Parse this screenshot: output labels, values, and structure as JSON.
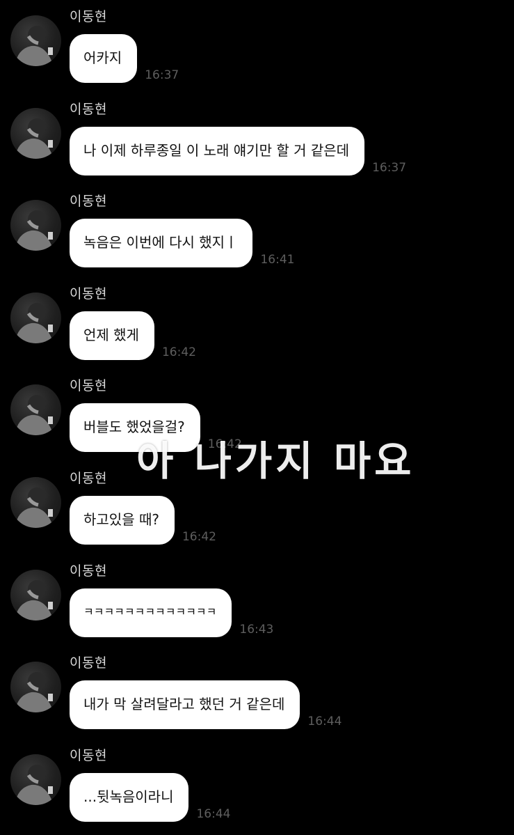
{
  "messages": [
    {
      "sender": "이동현",
      "text": "어카지",
      "time": "16:37"
    },
    {
      "sender": "이동현",
      "text": "나 이제 하루종일 이 노래 얘기만 할 거 같은데",
      "time": "16:37"
    },
    {
      "sender": "이동현",
      "text": "녹음은 이번에 다시 했지ㅣ",
      "time": "16:41"
    },
    {
      "sender": "이동현",
      "text": "언제 했게",
      "time": "16:42"
    },
    {
      "sender": "이동현",
      "text": "버블도 했었을걸?",
      "time": "16:42"
    },
    {
      "sender": "이동현",
      "text": "하고있을 때?",
      "time": "16:42"
    },
    {
      "sender": "이동현",
      "text": "ㅋㅋㅋㅋㅋㅋㅋㅋㅋㅋㅋㅋㅋ",
      "time": "16:43"
    },
    {
      "sender": "이동현",
      "text": "내가 막 살려달라고 했던 거 같은데",
      "time": "16:44"
    },
    {
      "sender": "이동현",
      "text": "...뒷녹음이라니",
      "time": "16:44"
    }
  ],
  "overlay_caption": "아 나가지 마요",
  "icons": {
    "avatar": "profile-photo"
  },
  "colors": {
    "background": "#000000",
    "bubble": "#ffffff",
    "bubble_text": "#111111",
    "sender_name": "#d9d9d9",
    "timestamp": "#5e5e5e"
  }
}
